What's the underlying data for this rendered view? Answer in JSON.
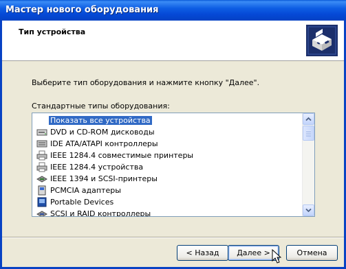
{
  "window": {
    "title": "Мастер нового оборудования"
  },
  "header": {
    "title": "Тип устройства",
    "icon": "hardware-wizard-icon"
  },
  "content": {
    "instruction": "Выберите тип оборудования и нажмите кнопку \"Далее\".",
    "list_label": "Стандартные типы оборудования:",
    "items": [
      {
        "label": "Показать все устройства",
        "icon": "blank-icon",
        "selected": true
      },
      {
        "label": "DVD и CD-ROM дисководы",
        "icon": "cd-drive-icon"
      },
      {
        "label": "IDE ATA/ATAPI контроллеры",
        "icon": "ide-controller-icon"
      },
      {
        "label": "IEEE 1284.4 совместимые принтеры",
        "icon": "printer-icon"
      },
      {
        "label": "IEEE 1284.4 устройства",
        "icon": "printer-icon"
      },
      {
        "label": "IEEE 1394 и SCSI-принтеры",
        "icon": "ieee1394-icon"
      },
      {
        "label": "PCMCIA адаптеры",
        "icon": "pcmcia-icon"
      },
      {
        "label": "Portable Devices",
        "icon": "portable-device-icon"
      },
      {
        "label": "SCSI и RAID контроллеры",
        "icon": "scsi-controller-icon"
      }
    ]
  },
  "buttons": {
    "back": "< Назад",
    "next": "Далее >",
    "cancel": "Отмена"
  }
}
